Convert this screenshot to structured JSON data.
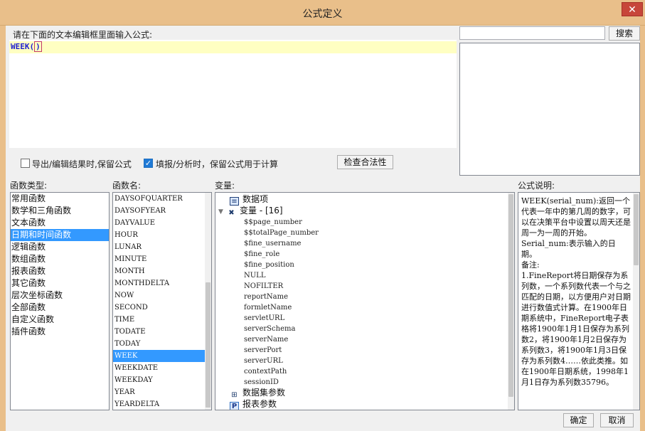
{
  "window": {
    "title": "公式定义",
    "close_label": "✕"
  },
  "editor": {
    "prompt": "请在下面的文本编辑框里面输入公式:",
    "formula_name": "WEEK(",
    "formula_paren": ")"
  },
  "search": {
    "input_value": "",
    "button_label": "搜索"
  },
  "options": {
    "keep_formula_on_export": {
      "label": "导出/编辑结果时,保留公式",
      "checked": false
    },
    "keep_formula_on_fill": {
      "label": "填报/分析时，保留公式用于计算",
      "checked": true
    }
  },
  "validate_button": "检查合法性",
  "function_types": {
    "label": "函数类型:",
    "items": [
      "常用函数",
      "数学和三角函数",
      "文本函数",
      "日期和时间函数",
      "逻辑函数",
      "数组函数",
      "报表函数",
      "其它函数",
      "层次坐标函数",
      "全部函数",
      "自定义函数",
      "插件函数"
    ],
    "selected_index": 3
  },
  "function_names": {
    "label": "函数名:",
    "items": [
      "DAYSOFQUARTER",
      "DAYSOFYEAR",
      "DAYVALUE",
      "HOUR",
      "LUNAR",
      "MINUTE",
      "MONTH",
      "MONTHDELTA",
      "NOW",
      "SECOND",
      "TIME",
      "TODATE",
      "TODAY",
      "WEEK",
      "WEEKDATE",
      "WEEKDAY",
      "YEAR",
      "YEARDELTA"
    ],
    "selected_index": 13
  },
  "variables": {
    "label": "变量:",
    "data_items": "数据项",
    "variables_group": "变量 - [16]",
    "items": [
      "$$page_number",
      "$$totalPage_number",
      "$fine_username",
      "$fine_role",
      "$fine_position",
      "NULL",
      "NOFILTER",
      "reportName",
      "formletName",
      "servletURL",
      "serverSchema",
      "serverName",
      "serverPort",
      "serverURL",
      "contextPath",
      "sessionID"
    ],
    "dataset_params": "数据集参数",
    "report_params": "报表参数"
  },
  "description": {
    "label": "公式说明:",
    "text": "WEEK(serial_num):返回一个代表一年中的第几周的数字，可以在决策平台中设置以周天还是周一为一周的开始。\nSerial_num:表示输入的日期。\n备注:\n1.FineReport将日期保存为系列数，一个系列数代表一个与之匹配的日期，以方便用户对日期进行数值式计算。在1900年日期系统中，FineReport电子表格将1900年1月1日保存为系列数2，将1900年1月2日保存为系列数3，将1900年1月3日保存为系列数4……依此类推。如在1900年日期系统，1998年1月1日存为系列数35796。"
  },
  "footer": {
    "ok_label": "确定",
    "cancel_label": "取消"
  }
}
